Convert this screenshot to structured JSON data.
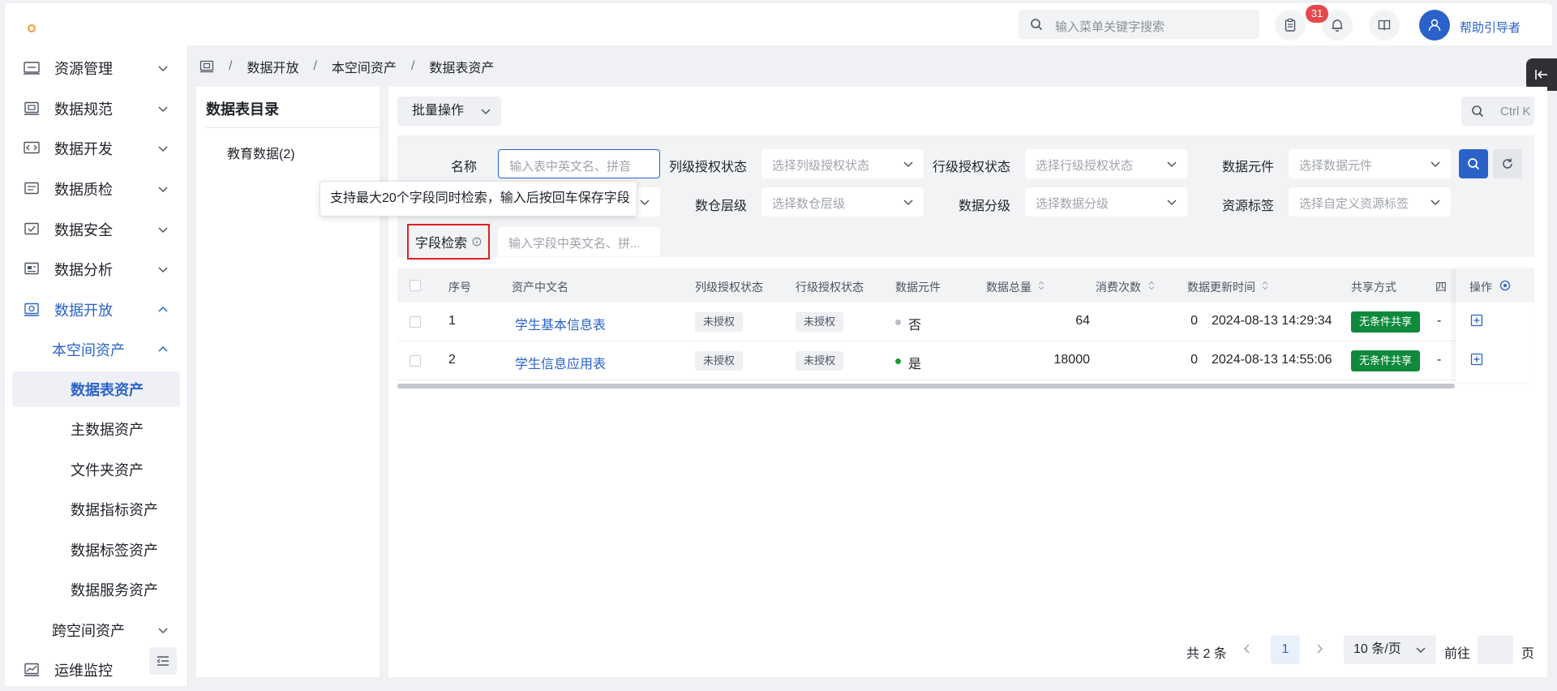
{
  "header": {
    "search_placeholder": "输入菜单关键字搜索",
    "notification_count": "31",
    "user_label": "帮助引导者"
  },
  "sidebar": {
    "items": [
      {
        "label": "资源管理",
        "icon": "resource-icon"
      },
      {
        "label": "数据规范",
        "icon": "monitor-icon"
      },
      {
        "label": "数据开发",
        "icon": "code-icon"
      },
      {
        "label": "数据质检",
        "icon": "quality-icon"
      },
      {
        "label": "数据安全",
        "icon": "security-icon"
      },
      {
        "label": "数据分析",
        "icon": "analysis-icon"
      },
      {
        "label": "数据开放",
        "icon": "open-icon"
      },
      {
        "label": "本空间资产"
      },
      {
        "label": "数据表资产"
      },
      {
        "label": "主数据资产"
      },
      {
        "label": "文件夹资产"
      },
      {
        "label": "数据指标资产"
      },
      {
        "label": "数据标签资产"
      },
      {
        "label": "数据服务资产"
      },
      {
        "label": "跨空间资产"
      },
      {
        "label": "运维监控",
        "icon": "monitor-chart-icon"
      }
    ]
  },
  "breadcrumb": [
    "数据开放",
    "本空间资产",
    "数据表资产"
  ],
  "tree": {
    "title": "数据表目录",
    "nodes": [
      "教育数据(2)"
    ]
  },
  "toolbar": {
    "batch_label": "批量操作",
    "quick_search": "Ctrl K"
  },
  "filters": {
    "name_label": "名称",
    "name_placeholder": "输入表中英文名、拼音",
    "col_auth_label": "列级授权状态",
    "col_auth_placeholder": "选择列级授权状态",
    "row_auth_label": "行级授权状态",
    "row_auth_placeholder": "选择行级授权状态",
    "element_label": "数据元件",
    "element_placeholder": "选择数据元件",
    "layer_label": "数仓层级",
    "layer_placeholder": "选择数仓层级",
    "grade_label": "数据分级",
    "grade_placeholder": "选择数据分级",
    "tag_label": "资源标签",
    "tag_placeholder": "选择自定义资源标签",
    "field_label": "字段检索",
    "field_placeholder": "输入字段中英文名、拼..."
  },
  "tooltip": "支持最大20个字段同时检索，输入后按回车保存字段",
  "table": {
    "headers": [
      "序号",
      "资产中文名",
      "列级授权状态",
      "行级授权状态",
      "数据元件",
      "数据总量",
      "消费次数",
      "数据更新时间",
      "共享方式",
      "四",
      "操作"
    ],
    "rows": [
      {
        "no": "1",
        "name": "学生基本信息表",
        "col_auth": "未授权",
        "row_auth": "未授权",
        "element": "否",
        "element_color": "#b8bcc4",
        "total": "64",
        "consume": "0",
        "updated": "2024-08-13 14:29:34",
        "share": "无条件共享",
        "extra": "-"
      },
      {
        "no": "2",
        "name": "学生信息应用表",
        "col_auth": "未授权",
        "row_auth": "未授权",
        "element": "是",
        "element_color": "#1a9a3c",
        "total": "18000",
        "consume": "0",
        "updated": "2024-08-13 14:55:06",
        "share": "无条件共享",
        "extra": "-"
      }
    ]
  },
  "pagination": {
    "total": "共 2 条",
    "current": "1",
    "page_size": "10 条/页",
    "goto": "前往",
    "page_unit": "页"
  },
  "colors": {
    "accent": "#2a62c9",
    "share_tag": "#0f8a3c",
    "badge": "#e5484d"
  }
}
